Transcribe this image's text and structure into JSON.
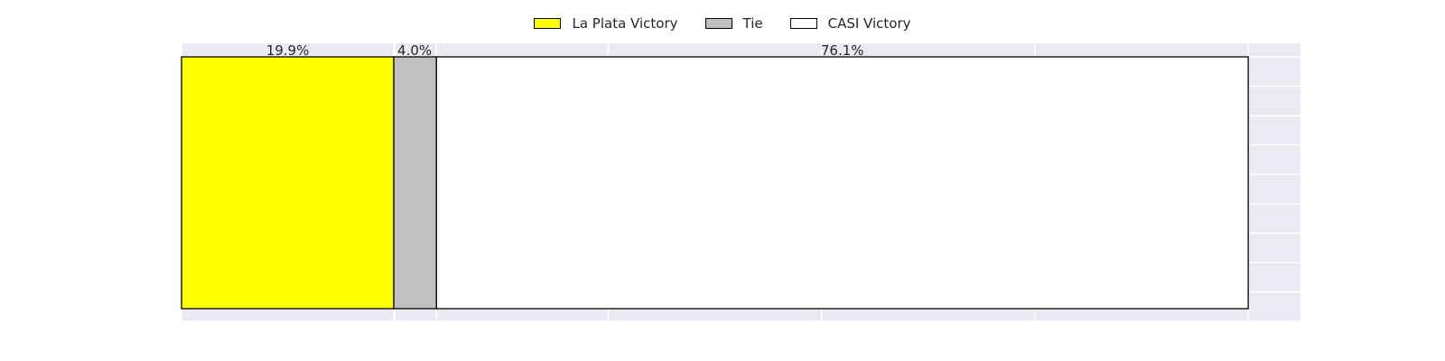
{
  "chart_data": {
    "type": "bar",
    "orientation": "horizontal",
    "stacked": true,
    "title": "",
    "xlabel": "",
    "ylabel": "",
    "xlim": [
      0,
      104.9
    ],
    "grid": true,
    "legend_position": "top-center",
    "series": [
      {
        "name": "La Plata Victory",
        "value": 19.9,
        "label": "19.9%",
        "color": "#ffff00"
      },
      {
        "name": "Tie",
        "value": 4.0,
        "label": "4.0%",
        "color": "#c0c0c0"
      },
      {
        "name": "CASI Victory",
        "value": 76.1,
        "label": "76.1%",
        "color": "#ffffff"
      }
    ]
  },
  "colors": {
    "plot_background": "#eaeaf2",
    "grid_line": "#ffffff",
    "bar_edge": "#000000",
    "text": "#262626"
  }
}
